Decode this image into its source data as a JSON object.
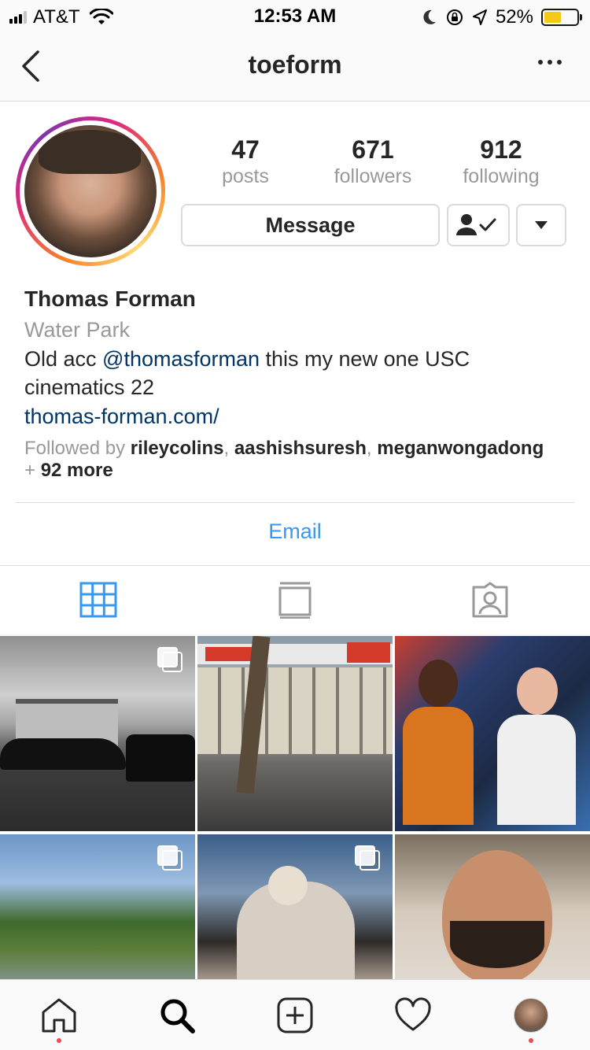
{
  "status_bar": {
    "carrier": "AT&T",
    "time": "12:53 AM",
    "battery": "52%",
    "battery_level": 0.52,
    "icons": [
      "signal-icon",
      "wifi-icon",
      "moon-icon",
      "rotation-lock-icon",
      "location-icon",
      "battery-icon"
    ]
  },
  "nav": {
    "title": "toeform",
    "back_icon": "chevron-left-icon",
    "more_icon": "more-dots-icon"
  },
  "profile": {
    "stats": [
      {
        "num": "47",
        "label": "posts"
      },
      {
        "num": "671",
        "label": "followers"
      },
      {
        "num": "912",
        "label": "following"
      }
    ],
    "message_label": "Message",
    "name": "Thomas Forman",
    "category": "Water Park",
    "bio_prefix": "Old acc ",
    "bio_mention": "@thomasforman",
    "bio_suffix": " this my new one USC cinematics 22",
    "website": "thomas-forman.com/",
    "followed_by_prefix": "Followed by ",
    "followed_by_users": [
      "rileycolins",
      "aashishsuresh",
      "meganwongadong"
    ],
    "followed_by_sep": ", ",
    "followed_by_more_prefix": "+ ",
    "followed_by_more": "92 more"
  },
  "contact": {
    "email_label": "Email"
  },
  "tabs": [
    "grid-icon",
    "feed-icon",
    "tagged-icon"
  ],
  "grid": {
    "posts": [
      {
        "name": "post-street-houses",
        "multi": true
      },
      {
        "name": "post-city-store",
        "multi": false
      },
      {
        "name": "post-two-men",
        "multi": false
      },
      {
        "name": "post-trees-plane",
        "multi": true
      },
      {
        "name": "post-embrace",
        "multi": true
      },
      {
        "name": "post-portrait-hand",
        "multi": false
      }
    ]
  },
  "tabbar": {
    "items": [
      "home-icon",
      "search-icon",
      "new-post-icon",
      "activity-heart-icon",
      "profile-avatar"
    ]
  },
  "colors": {
    "link": "#003569",
    "accent_blue": "#3897f0",
    "notification": "#ed4956",
    "muted": "#999999"
  }
}
